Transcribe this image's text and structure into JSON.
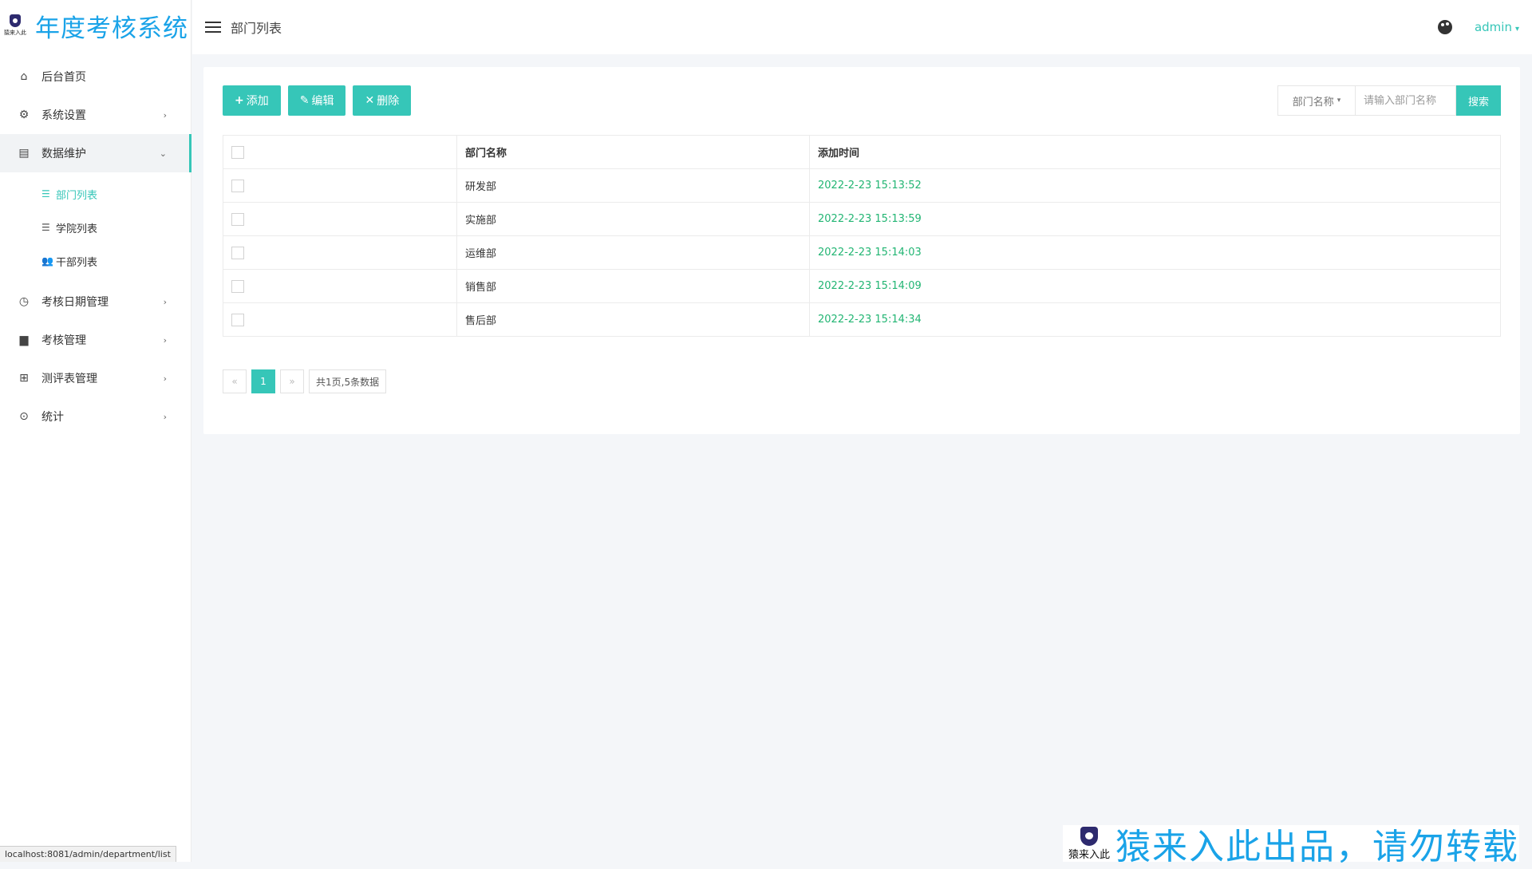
{
  "brand": {
    "logo_text": "猿来入此",
    "title": "年度考核系统"
  },
  "menu": [
    {
      "label": "后台首页",
      "icon": "home-icon",
      "chevron": ""
    },
    {
      "label": "系统设置",
      "icon": "gear-icon",
      "chevron": "›"
    },
    {
      "label": "数据维护",
      "icon": "calendar-icon",
      "chevron": "⌄"
    },
    {
      "label": "考核日期管理",
      "icon": "clock-icon",
      "chevron": "›"
    },
    {
      "label": "考核管理",
      "icon": "document-icon",
      "chevron": "›"
    },
    {
      "label": "测评表管理",
      "icon": "grid-icon",
      "chevron": "›"
    },
    {
      "label": "统计",
      "icon": "target-icon",
      "chevron": "›"
    }
  ],
  "submenu": [
    {
      "label": "部门列表",
      "icon": "list-icon"
    },
    {
      "label": "学院列表",
      "icon": "list-icon"
    },
    {
      "label": "干部列表",
      "icon": "users-icon"
    }
  ],
  "topbar": {
    "title": "部门列表",
    "user": "admin"
  },
  "toolbar": {
    "add": "添加",
    "edit": "编辑",
    "delete": "删除"
  },
  "search": {
    "field": "部门名称",
    "placeholder": "请输入部门名称",
    "button": "搜索"
  },
  "table": {
    "headers": [
      "",
      "部门名称",
      "添加时间"
    ],
    "rows": [
      {
        "name": "研发部",
        "time": "2022-2-23 15:13:52"
      },
      {
        "name": "实施部",
        "time": "2022-2-23 15:13:59"
      },
      {
        "name": "运维部",
        "time": "2022-2-23 15:14:03"
      },
      {
        "name": "销售部",
        "time": "2022-2-23 15:14:09"
      },
      {
        "name": "售后部",
        "time": "2022-2-23 15:14:34"
      }
    ]
  },
  "pagination": {
    "prev": "«",
    "current": "1",
    "next": "»",
    "info": "共1页,5条数据"
  },
  "status_url": "localhost:8081/admin/department/list",
  "watermark": {
    "logo_text": "猿来入此",
    "text": "猿来入此出品，请勿转载"
  },
  "colors": {
    "accent": "#36c6b8",
    "brand": "#1aa3e8",
    "time": "#22b573"
  }
}
